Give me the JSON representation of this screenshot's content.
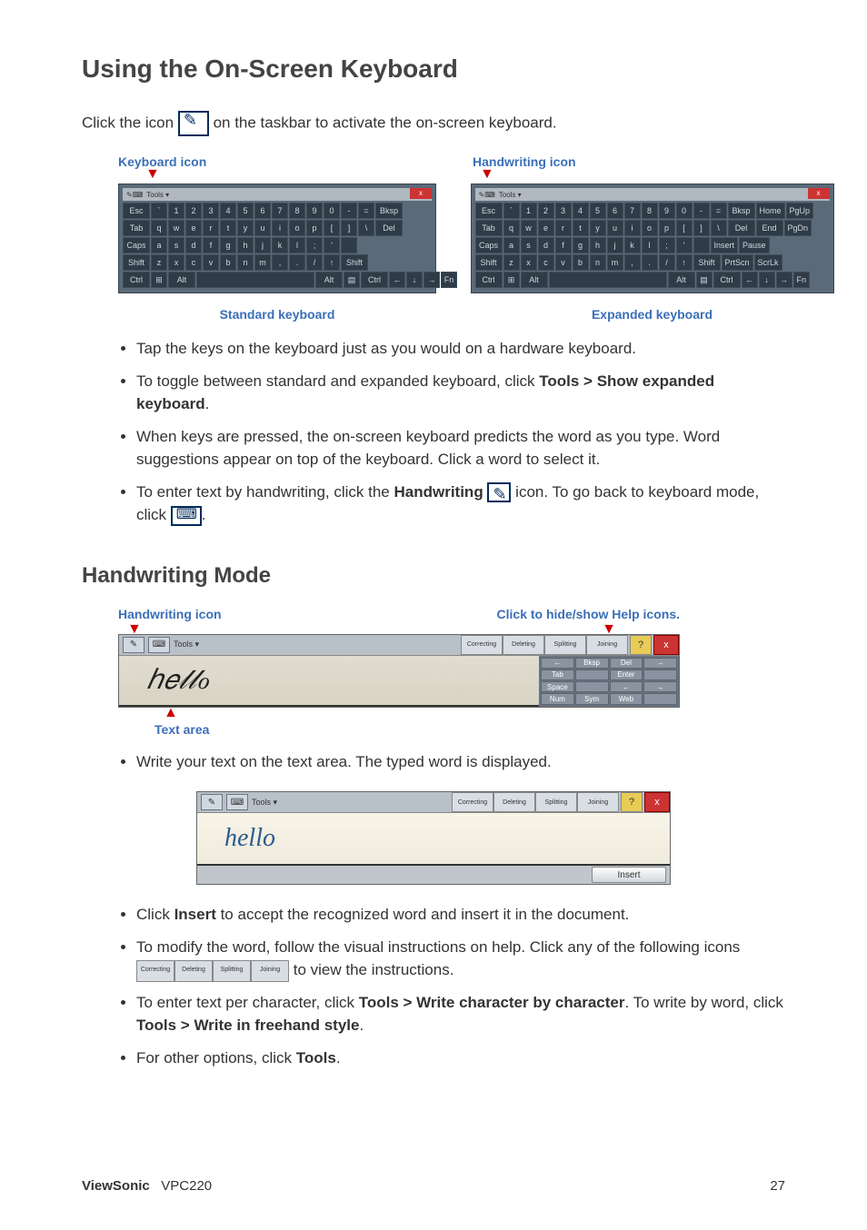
{
  "heading1": "Using the On-Screen Keyboard",
  "intro_prefix": "Click the icon ",
  "intro_suffix": " on the taskbar to activate the on-screen keyboard.",
  "kb_labels": {
    "kb_icon": "Keyboard icon",
    "hw_icon": "Handwriting icon",
    "std_caption": "Standard keyboard",
    "exp_caption": "Expanded keyboard"
  },
  "keyboard": {
    "tools": "Tools ▾",
    "close": "x",
    "row1": [
      "Esc",
      "`",
      "1",
      "2",
      "3",
      "4",
      "5",
      "6",
      "7",
      "8",
      "9",
      "0",
      "-",
      "=",
      "Bksp"
    ],
    "row2": [
      "Tab",
      "q",
      "w",
      "e",
      "r",
      "t",
      "y",
      "u",
      "i",
      "o",
      "p",
      "[",
      "]",
      "\\",
      "Del"
    ],
    "row3": [
      "Caps",
      "a",
      "s",
      "d",
      "f",
      "g",
      "h",
      "j",
      "k",
      "l",
      ";",
      "'",
      " "
    ],
    "row4": [
      "Shift",
      "z",
      "x",
      "c",
      "v",
      "b",
      "n",
      "m",
      ",",
      ".",
      "/",
      "↑",
      "Shift"
    ],
    "row5": [
      "Ctrl",
      "⊞",
      "Alt",
      " ",
      "Alt",
      "▤",
      "Ctrl",
      "←",
      "↓",
      "→",
      "Fn"
    ],
    "extra_cols": [
      [
        "Home",
        "PgUp"
      ],
      [
        "End",
        "PgDn"
      ],
      [
        "Insert",
        "Pause"
      ],
      [
        "PrtScn",
        "ScrLk"
      ]
    ]
  },
  "bullets1": {
    "b1": "Tap the keys on the keyboard just as you would on a hardware keyboard.",
    "b2_pre": "To toggle between standard and expanded keyboard, click ",
    "b2_bold": "Tools > Show expanded keyboard",
    "b2_post": ".",
    "b3": "When keys are pressed, the on-screen keyboard predicts the word as you type. Word suggestions appear on top of the keyboard. Click a word to select it.",
    "b4_pre": "To enter text by handwriting, click the ",
    "b4_bold": "Handwriting",
    "b4_mid": " ",
    "b4_post": " icon. To go back to keyboard mode, click "
  },
  "heading2": "Handwriting Mode",
  "hw_labels": {
    "hw_icon": "Handwriting icon",
    "help_hint": "Click to hide/show Help icons.",
    "text_area": "Text area"
  },
  "hw_panel": {
    "tools": "Tools ▾",
    "help_buttons": [
      "Correcting",
      "Deleting",
      "Splitting",
      "Joining"
    ],
    "question": "?",
    "close": "x",
    "scribble": "hello",
    "side": [
      "←",
      "Bksp",
      "Del",
      "→",
      "Tab",
      "",
      "Enter",
      "",
      "Space",
      "",
      "←",
      "→",
      "Num",
      "Sym",
      "Web",
      ""
    ],
    "insert": "Insert",
    "recognized": "hello"
  },
  "bullets2": {
    "b1": "Write your text on the text area. The typed word is displayed.",
    "b2_pre": "Click ",
    "b2_bold": "Insert",
    "b2_post": " to accept the recognized word and insert it in the document.",
    "b3_pre": "To modify the word, follow the visual instructions on help. Click any of the following icons ",
    "b3_post": " to view the instructions.",
    "b4_pre": "To enter text per character, click ",
    "b4_bold": "Tools > Write character by character",
    "b4_mid": ". To write by word, click ",
    "b4_bold2": "Tools > Write in freehand style",
    "b4_post": ".",
    "b5_pre": "For other options, click ",
    "b5_bold": "Tools",
    "b5_post": "."
  },
  "footer": {
    "brand": "ViewSonic",
    "model": "VPC220",
    "page": "27"
  }
}
